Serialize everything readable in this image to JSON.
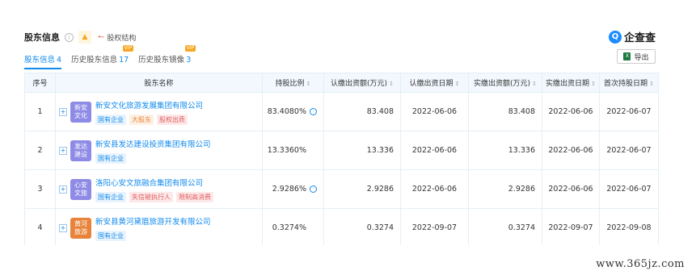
{
  "header": {
    "title": "股东信息",
    "equity_label": "股权结构",
    "logo_mark": "Q",
    "logo_name": "企查查",
    "export_label": "导出"
  },
  "tabs": [
    {
      "label": "股东信息",
      "count": "4",
      "active": true,
      "vip": ""
    },
    {
      "label": "历史股东信息",
      "count": "17",
      "active": false,
      "vip": "VIP"
    },
    {
      "label": "历史股东镜像",
      "count": "3",
      "active": false,
      "vip": "VIP"
    }
  ],
  "table": {
    "columns": [
      "序号",
      "股东名称",
      "持股比例",
      "认缴出资额(万元)",
      "认缴出资日期",
      "实缴出资额(万元)",
      "实缴出资日期",
      "首次持股日期"
    ],
    "rows": [
      {
        "index": "1",
        "avatar_text": "新安文化",
        "avatar_color": "#8e8be6",
        "name": "新安文化旅游发展集团有限公司",
        "tags": [
          {
            "text": "国有企业",
            "style": "blue"
          },
          {
            "text": "大股东",
            "style": "orange"
          },
          {
            "text": "股权出质",
            "style": "red"
          }
        ],
        "ratio": "83.4080%",
        "ratio_clock": true,
        "subscribed_amount": "83.408",
        "subscribed_date": "2022-06-06",
        "paid_amount": "83.408",
        "paid_date": "2022-06-06",
        "first_date": "2022-06-07"
      },
      {
        "index": "2",
        "avatar_text": "发达建设",
        "avatar_color": "#8e8be6",
        "name": "新安县发达建设投资集团有限公司",
        "tags": [
          {
            "text": "国有企业",
            "style": "blue"
          }
        ],
        "ratio": "13.3360%",
        "ratio_clock": false,
        "subscribed_amount": "13.336",
        "subscribed_date": "2022-06-06",
        "paid_amount": "13.336",
        "paid_date": "2022-06-06",
        "first_date": "2022-06-07"
      },
      {
        "index": "3",
        "avatar_text": "心安文旅",
        "avatar_color": "#8e8be6",
        "name": "洛阳心安文旅融合集团有限公司",
        "tags": [
          {
            "text": "国有企业",
            "style": "blue"
          },
          {
            "text": "失信被执行人",
            "style": "red"
          },
          {
            "text": "限制高消费",
            "style": "red"
          }
        ],
        "ratio": "2.9286%",
        "ratio_clock": true,
        "subscribed_amount": "2.9286",
        "subscribed_date": "2022-06-06",
        "paid_amount": "2.9286",
        "paid_date": "2022-06-06",
        "first_date": "2022-06-07"
      },
      {
        "index": "4",
        "avatar_text": "黄河旅游",
        "avatar_color": "#e8833a",
        "name": "新安县黄河黛眉旅游开发有限公司",
        "tags": [
          {
            "text": "国有企业",
            "style": "blue"
          }
        ],
        "ratio": "0.3274%",
        "ratio_clock": false,
        "subscribed_amount": "0.3274",
        "subscribed_date": "2022-09-07",
        "paid_amount": "0.3274",
        "paid_date": "2022-09-07",
        "first_date": "2022-09-08"
      }
    ]
  },
  "watermark": "www.365jz.com"
}
